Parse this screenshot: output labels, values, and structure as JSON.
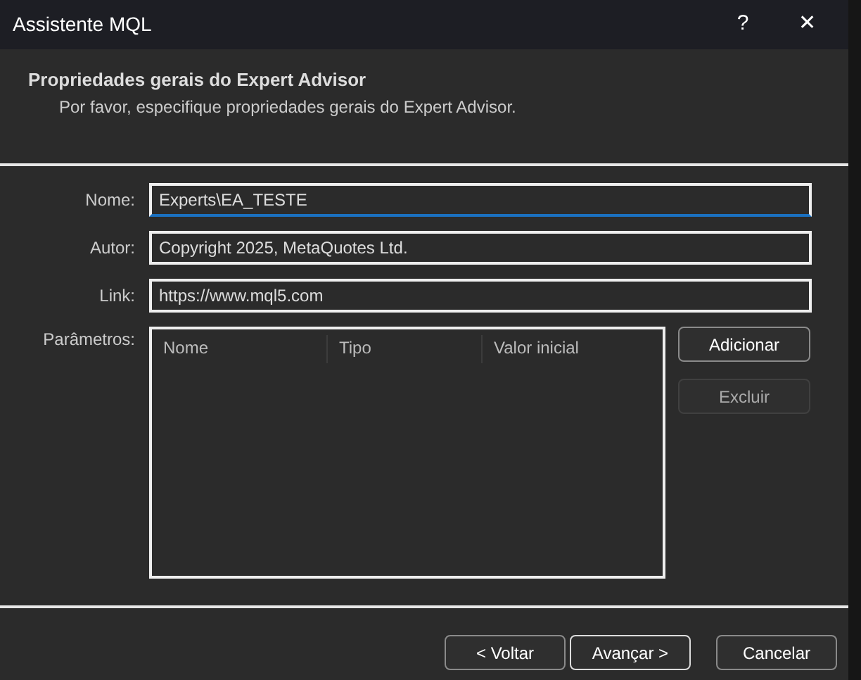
{
  "window": {
    "title": "Assistente MQL",
    "help": "?",
    "close": "✕"
  },
  "header": {
    "title": "Propriedades gerais do Expert Advisor",
    "subtitle": "Por favor, especifique propriedades gerais do Expert Advisor."
  },
  "fields": [
    {
      "label": "Nome:",
      "value": "Experts\\EA_TESTE",
      "focused": true
    },
    {
      "label": "Autor:",
      "value": "Copyright 2025, MetaQuotes Ltd.",
      "focused": false
    },
    {
      "label": "Link:",
      "value": "https://www.mql5.com",
      "focused": false
    }
  ],
  "parameters": {
    "label": "Parâmetros:",
    "columns": [
      "Nome",
      "Tipo",
      "Valor inicial"
    ]
  },
  "side_buttons": [
    {
      "label": "Adicionar",
      "disabled": false
    },
    {
      "label": "Excluir",
      "disabled": true
    }
  ],
  "footer_buttons": [
    {
      "label": "< Voltar",
      "default": false
    },
    {
      "label": "Avançar >",
      "default": true
    },
    {
      "label": "Cancelar",
      "default": false
    }
  ]
}
